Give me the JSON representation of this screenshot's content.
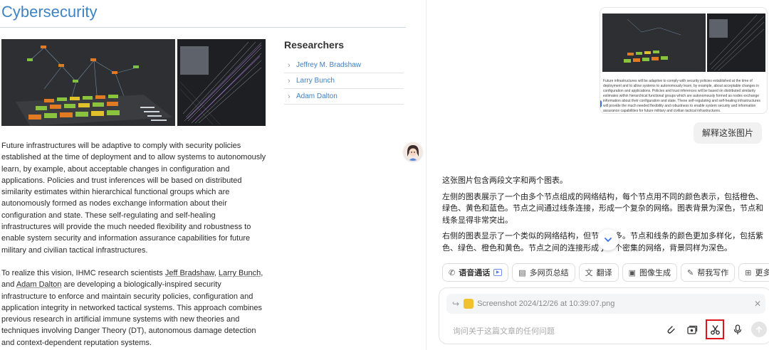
{
  "article": {
    "title": "Cybersecurity",
    "researchers_heading": "Researchers",
    "researchers": [
      "Jeffrey M. Bradshaw",
      "Larry Bunch",
      "Adam Dalton"
    ],
    "para1": "Future infrastructures will be adaptive to comply with security policies established at the time of deployment and to allow systems to autonomously learn, by example, about acceptable changes in configuration and applications. Policies and trust inferences will be based on distributed similarity estimates within hierarchical functional groups which are autonomously formed as nodes exchange information about their configuration and state. These self-regulating and self-healing infrastructures will provide the much needed flexibility and robustness to enable system security and information assurance capabilities for future military and civilian tactical infrastructures.",
    "para2": {
      "p1": "To realize this vision, IHMC research scientists ",
      "n1": "Jeff Bradshaw",
      "p2": ", ",
      "n2": "Larry Bunch",
      "p3": ", and ",
      "n3": "Adam Dalton",
      "p4": " are developing a biologically-inspired security infrastructure to enforce and maintain security policies, configuration and application integrity in networked tactical systems. This approach combines previous research in artificial immune systems with new theories and techniques involving Danger Theory (DT), autonomous damage detection and context-dependent reputation systems."
    }
  },
  "chat": {
    "thumb_caption": "Future infrastructures will be adaptive to comply with security policies established at the time of deployment and to allow systems to autonomously learn, by example, about acceptable changes in configuration and applications. Policies and trust inferences will be based on distributed similarity estimates within hierarchical functional groups which are autonomously formed as nodes exchange information about their configuration and state. These self-regulating and self-healing infrastructures will provide the much needed flexibility and robustness to enable system security and information assurance capabilities for future military and civilian tactical infrastructures.",
    "user_message": "解释这张图片",
    "answer": [
      "这张图片包含两段文字和两个图表。",
      "左侧的图表展示了一个由多个节点组成的网络结构，每个节点用不同的颜色表示，包括橙色、绿色、黄色和蓝色。节点之间通过线条连接，形成一个复杂的网络。图表背景为深色，节点和线条显得非常突出。",
      "右侧的图表显示了一个类似的网络结构，但节点更多。节点和线条的颜色更加多样化，包括紫色、绿色、橙色和黄色。节点之间的连接形成了一个密集的网络，背景同样为深色。"
    ],
    "tools": [
      {
        "label": "语音通话",
        "icon": "phone-icon"
      },
      {
        "label": "多网页总结",
        "icon": "document-icon"
      },
      {
        "label": "翻译",
        "icon": "translate-icon"
      },
      {
        "label": "图像生成",
        "icon": "image-icon"
      },
      {
        "label": "帮我写作",
        "icon": "pen-icon"
      },
      {
        "label": "更多",
        "icon": "grid-icon"
      }
    ],
    "attachment_name": "Screenshot 2024/12/26 at 10:39:07.png",
    "input_placeholder": "询问关于这篇文章的任何问题"
  },
  "colors": {
    "title": "#3f83c3",
    "link": "#3f7fc1",
    "highlight_box": "#e0141e"
  }
}
